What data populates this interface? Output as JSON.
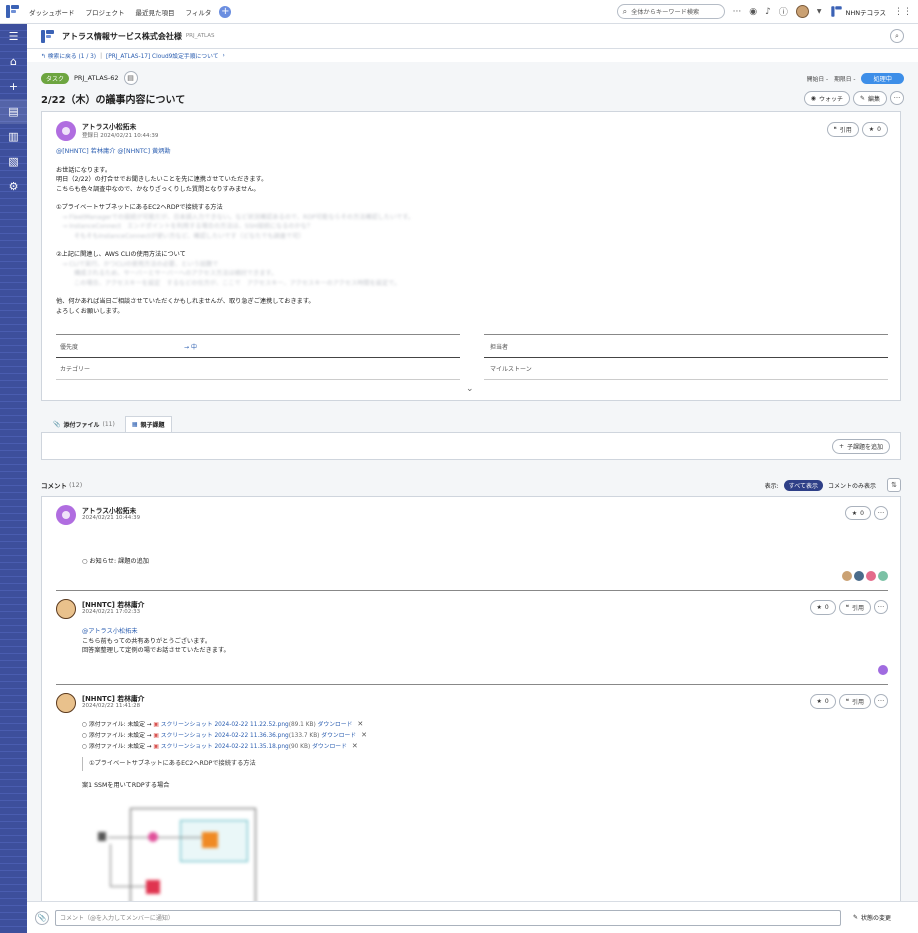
{
  "topbar": {
    "nav": [
      "ダッシュボード",
      "プロジェクト",
      "最近見た項目",
      "フィルタ"
    ],
    "search_placeholder": "全体からキーワード検索",
    "org": "NHNテコラス"
  },
  "project": {
    "title": "アトラス情報サービス株式会社様",
    "key": "PRJ_ATLAS"
  },
  "breadcrumb": {
    "back": "検索に戻る (1 / 3)",
    "parent": "[PRJ_ATLAS-17] Cloud9設定手順について"
  },
  "issue": {
    "type": "タスク",
    "key": "PRJ_ATLAS-62",
    "start_label": "開始日 -",
    "due_label": "期限日 -",
    "status": "処理中",
    "title": "2/22（木）の議事内容について",
    "watch": "ウォッチ",
    "edit": "編集"
  },
  "post": {
    "author": "アトラス小松拓未",
    "date": "登録日 2024/02/21 10:44:39",
    "quote": "引用",
    "star": "0",
    "mentions": "@[NHNTC] 若林庸介 @[NHNTC] 黄炳勳",
    "lines": [
      "お世話になります。",
      "明日（2/22）の打合せでお聞きしたいことを先に連携させていただきます。",
      "こちらも色々調査中なので、かなりざっくりした質問となりすみません。",
      "①プライベートサブネットにあるEC2へRDPで接続する方法",
      "②上記に関連し、AWS CLIの使用方法について",
      "他、何かあれば当日ご相談させていただくかもしれませんが、取り急ぎご連携しておきます。",
      "よろしくお願いします。"
    ],
    "blurred": [
      "FleetManagerでの接続が可能だが、日本語入力できない。など状況確認あるので、RDP可能ならその方法確認したいです。",
      "InstanceConnect　エンドポイントを利用する場合の方法は、SSH接続になるのかな？",
      "そもそもInstanceConnectが使い方など、確認したいです（どなたでも調査で可）",
      "CLIで実行、かつCLIの使用方法の必要、という話題で",
      "構成されるため、サーバーとサーバーへのアクセス方法は検討できます。",
      "この場合、アクセスキーを設定　するなどの仕方が、ここで　アクセスキー、アクセスキーのアクセス時間を設定で。"
    ]
  },
  "fields": {
    "priority_label": "優先度",
    "priority_value": "中",
    "assignee_label": "担当者",
    "category_label": "カテゴリー",
    "milestone_label": "マイルストーン"
  },
  "tabs": {
    "attach": "添付ファイル",
    "attach_count": "(11)",
    "child": "親子課題",
    "add_child": "子課題を追加"
  },
  "comments": {
    "label": "コメント",
    "count": "(12)",
    "display": "表示:",
    "all": "すべて表示",
    "only": "コメントのみ表示"
  },
  "c1": {
    "author": "アトラス小松拓未",
    "date": "2024/02/21 10:44:39",
    "star": "0",
    "text": "○ お知らせ: 課題の追加"
  },
  "c2": {
    "author": "[NHNTC] 若林庸介",
    "date": "2024/02/21 17:02:33",
    "star": "0",
    "quote": "引用",
    "mention": "@アトラス小松拓未",
    "lines": [
      "こちら前もっての共有ありがとうございます。",
      "回答案整理して定例の場でお話させていただきます。"
    ]
  },
  "c3": {
    "author": "[NHNTC] 若林庸介",
    "date": "2024/02/22 11:41:28",
    "star": "0",
    "quote": "引用",
    "files": [
      {
        "prefix": "○ 添付ファイル: 未設定 →",
        "name": "スクリーンショット 2024-02-22 11.22.52.png",
        "size": "(89.1 KB)",
        "dl": "ダウンロード"
      },
      {
        "prefix": "○ 添付ファイル: 未設定 →",
        "name": "スクリーンショット 2024-02-22 11.36.36.png",
        "size": "(133.7 KB)",
        "dl": "ダウンロード"
      },
      {
        "prefix": "○ 添付ファイル: 未設定 →",
        "name": "スクリーンショット 2024-02-22 11.35.18.png",
        "size": "(90 KB)",
        "dl": "ダウンロード"
      }
    ],
    "quote_text": "①プライベートサブネットにあるEC2へRDPで接続する方法",
    "plan": "案1 SSMを用いてRDPする場合"
  },
  "footer": {
    "placeholder": "コメント（@を入力してメンバーに通知）",
    "status_change": "状態の変更"
  }
}
